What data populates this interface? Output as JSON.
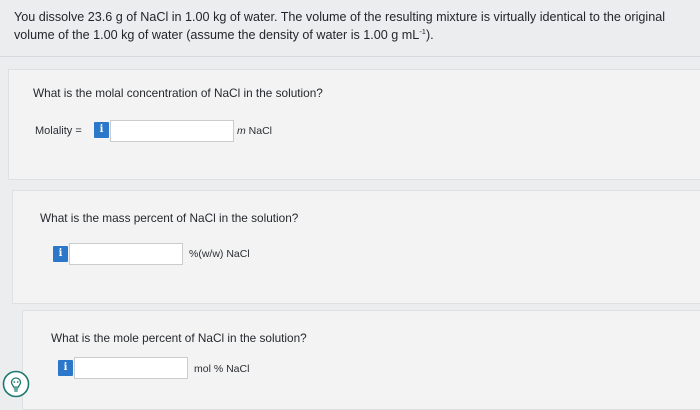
{
  "problem": {
    "text_before_sup": "You dissolve 23.6 g of NaCl in 1.00 kg of water. The volume of the resulting mixture is virtually identical to the original volume of the 1.00 kg of water (assume the density of water is 1.00 g mL",
    "superscript": "-1",
    "text_after_sup": ")."
  },
  "q1": {
    "question": "What is the molal concentration of NaCl in the solution?",
    "field_label": "Molality =",
    "info_glyph": "i",
    "value": "",
    "unit_italic": "m",
    "unit": " NaCl"
  },
  "q2": {
    "question": "What is the mass percent of NaCl in the solution?",
    "info_glyph": "i",
    "value": "",
    "unit": "%(w/w) NaCl"
  },
  "q3": {
    "question": "What is the mole percent of NaCl in the solution?",
    "info_glyph": "i",
    "value": "",
    "unit": "mol % NaCl"
  },
  "icons": {
    "info": "info-icon",
    "help": "hint-lightbulb-icon"
  },
  "colors": {
    "info_badge": "#2b77c9",
    "card_background": "#f3f3f4",
    "page_background": "#ecedef"
  }
}
